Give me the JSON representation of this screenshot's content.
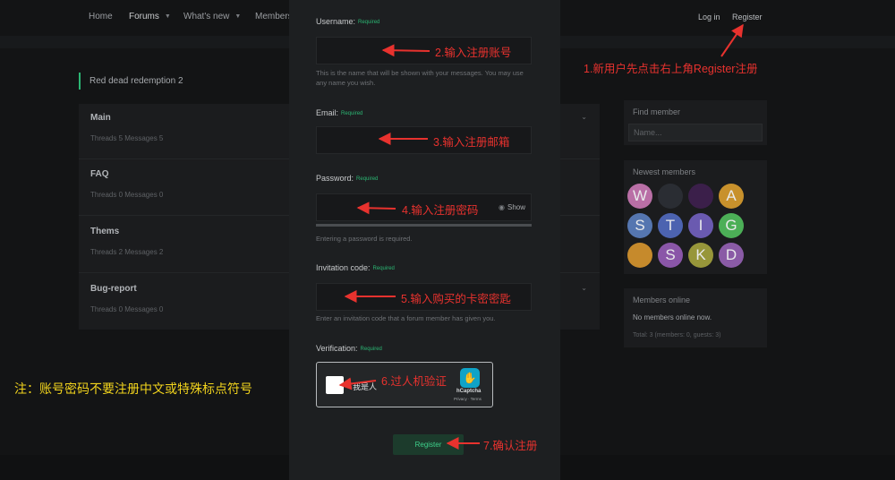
{
  "nav": {
    "home": "Home",
    "forums": "Forums",
    "whats_new": "What's new",
    "members": "Members",
    "login": "Log in",
    "register": "Register"
  },
  "breadcrumb": "Red dead redemption 2",
  "forums": [
    {
      "title": "Main",
      "stats": "Threads 5  Messages 5"
    },
    {
      "title": "FAQ",
      "stats": "Threads 0  Messages 0"
    },
    {
      "title": "Thems",
      "stats": "Threads 2  Messages 2"
    },
    {
      "title": "Bug-report",
      "stats": "Threads 0  Messages 0"
    }
  ],
  "sidebar": {
    "find_member_title": "Find member",
    "find_member_placeholder": "Name...",
    "newest_members_title": "Newest members",
    "newest_members": [
      {
        "letter": "W",
        "color": "#b96fa6"
      },
      {
        "letter": "",
        "color": "#2a2d33"
      },
      {
        "letter": "",
        "color": "#3b1f4a"
      },
      {
        "letter": "A",
        "color": "#c8912c"
      },
      {
        "letter": "S",
        "color": "#5576b0"
      },
      {
        "letter": "T",
        "color": "#4c63b0"
      },
      {
        "letter": "I",
        "color": "#6a5ab0"
      },
      {
        "letter": "G",
        "color": "#4caf57"
      },
      {
        "letter": "",
        "color": "#c68a2c"
      },
      {
        "letter": "S",
        "color": "#8a56a8"
      },
      {
        "letter": "K",
        "color": "#97963a"
      },
      {
        "letter": "D",
        "color": "#8a5ba6"
      }
    ],
    "members_online_title": "Members online",
    "members_online_text": "No members online now.",
    "members_online_total": "Total: 3 (members: 0, guests: 3)"
  },
  "form": {
    "username_label": "Username:",
    "username_hint": "This is the name that will be shown with your messages. You may use any name you wish.",
    "email_label": "Email:",
    "password_label": "Password:",
    "password_show": "Show",
    "password_hint": "Entering a password is required.",
    "invitation_label": "Invitation code:",
    "invitation_hint": "Enter an invitation code that a forum member has given you.",
    "verification_label": "Verification:",
    "required": "Required",
    "captcha_label": "我是人",
    "captcha_brand": "hCaptcha",
    "captcha_terms": "Privacy · Terms",
    "submit": "Register"
  },
  "annotations": {
    "step1": "1.新用户先点击右上角Register注册",
    "step2": "2.输入注册账号",
    "step3": "3.输入注册邮箱",
    "step4": "4.输入注册密码",
    "step5": "5.输入购买的卡密密匙",
    "step6": "6.过人机验证",
    "step7": "7.确认注册",
    "note": "注：账号密码不要注册中文或特殊标点符号"
  },
  "colors": {
    "accent_green": "#2bb673",
    "annotation_red": "#e8322e",
    "note_yellow": "#f2d41d"
  }
}
